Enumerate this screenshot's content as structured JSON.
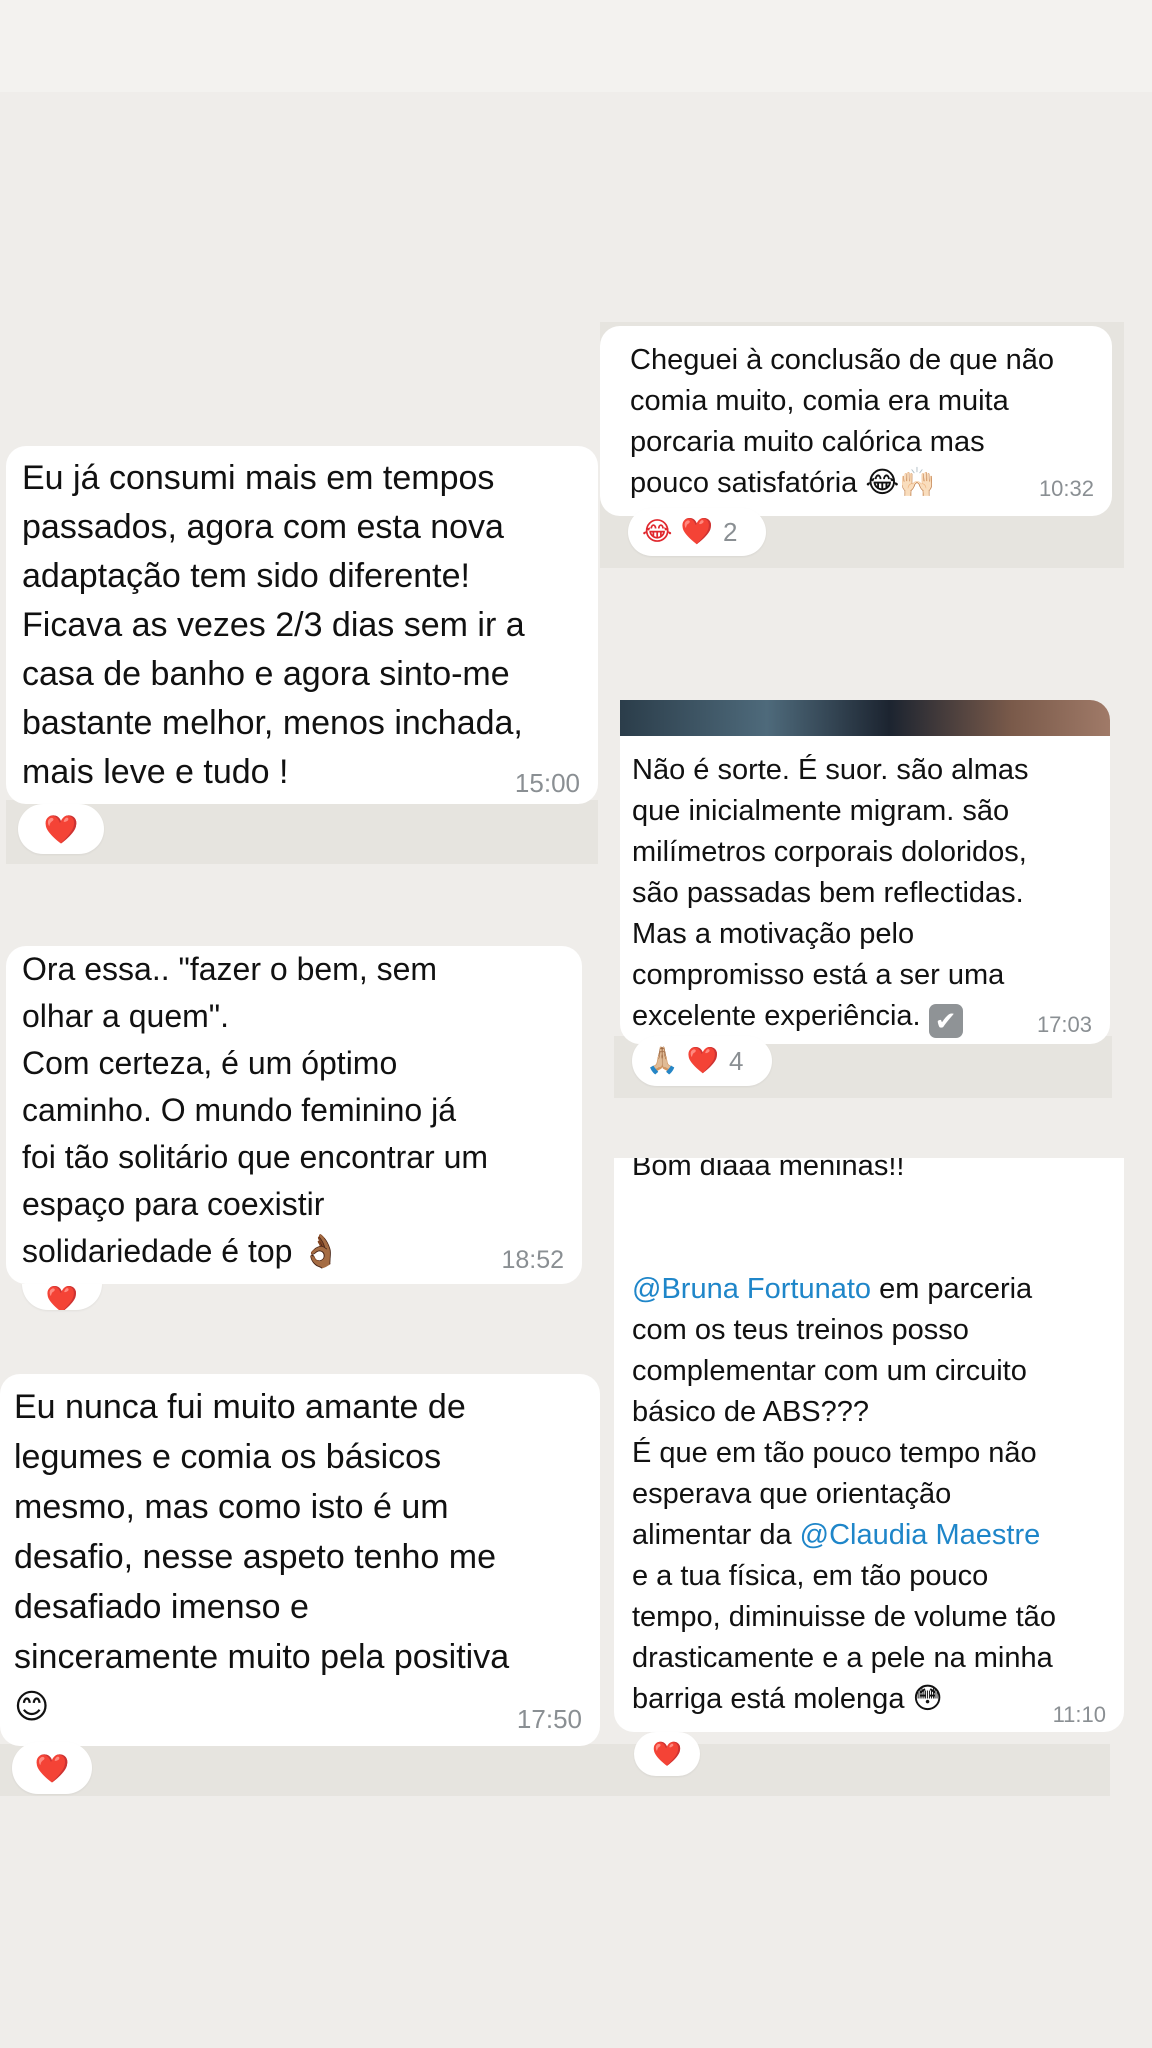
{
  "messages": [
    {
      "text": "Cheguei à conclusão de que não\ncomia muito, comia era muita\nporcaria muito calórica mas\npouco satisfatória 😂🙌🏻",
      "time": "10:32",
      "reactions": {
        "emoji": "😂 ❤️",
        "count": "2"
      }
    },
    {
      "text": "Eu já consumi mais em tempos\npassados, agora com esta nova\nadaptação tem sido diferente!\nFicava as vezes 2/3 dias sem ir a\ncasa de banho e agora sinto-me\nbastante melhor, menos inchada,\nmais leve e tudo !",
      "time": "15:00",
      "reactions": {
        "emoji": "❤️"
      }
    },
    {
      "text": "Não é sorte. É suor. são almas\nque inicialmente migram. são\nmilímetros corporais doloridos,\nsão passadas bem reflectidas.\nMas a motivação pelo\ncompromisso está a ser uma\nexcelente experiência.",
      "check_icon": "✔",
      "time": "17:03",
      "reactions": {
        "emoji": "🙏🏼 ❤️",
        "count": "4"
      }
    },
    {
      "text": "Ora essa.. \"fazer o bem, sem\nolhar a quem\".\nCom certeza, é um óptimo\ncaminho. O mundo feminino já\nfoi tão solitário que encontrar um\nespaço para coexistir\nsolidariedade é top 👌🏾",
      "time": "18:52",
      "reactions": {
        "emoji": "❤️"
      }
    },
    {
      "text_top": "Bom diaaa meninas!!",
      "mention1": "@Bruna Fortunato",
      "text_a": "  em parceria\ncom os teus treinos posso\ncomplementar com um circuito\nbásico de ABS???\nÉ que em tão pouco tempo não\nesperava que orientação\nalimentar da ",
      "mention2": "@Claudia Maestre",
      "text_b": "\ne a tua física, em tão pouco\ntempo, diminuisse de volume tão\ndrasticamente e a pele na minha\nbarriga está molenga 😳",
      "time": "11:10",
      "reactions": {
        "emoji": "❤️"
      }
    },
    {
      "text": "Eu nunca fui muito amante de\nlegumes e comia os básicos\nmesmo, mas como isto é um\ndesafio, nesse aspeto tenho me\ndesafiado imenso e\nsinceramente muito pela positiva\n😊",
      "time": "17:50",
      "reactions": {
        "emoji": "❤️"
      }
    }
  ]
}
